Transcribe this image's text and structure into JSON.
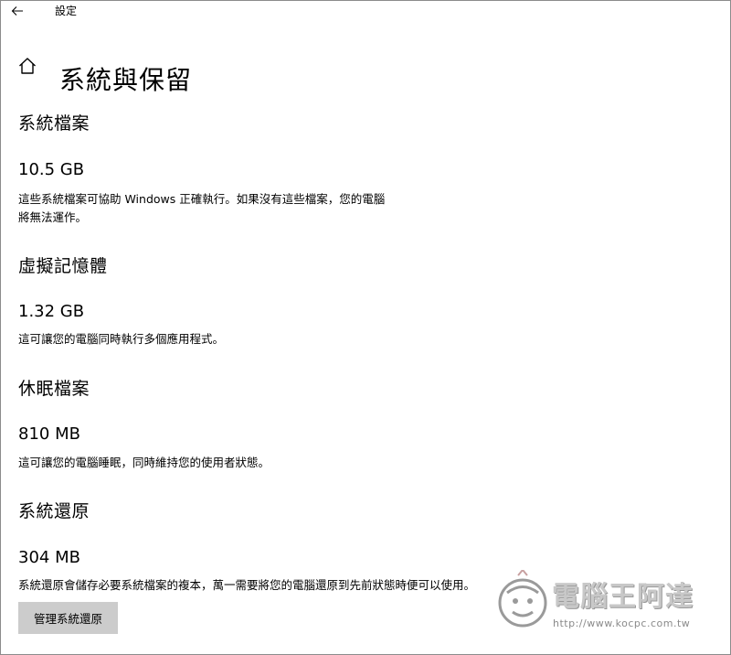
{
  "window": {
    "title": "設定"
  },
  "page": {
    "title": "系統與保留"
  },
  "sections": [
    {
      "heading": "系統檔案",
      "size": "10.5 GB",
      "description_line1": "這些系統檔案可協助 Windows 正確執行。如果沒有這些檔案，您的電腦",
      "description_line2": "將無法運作。"
    },
    {
      "heading": "虛擬記憶體",
      "size": "1.32 GB",
      "description_line1": "這可讓您的電腦同時執行多個應用程式。"
    },
    {
      "heading": "休眠檔案",
      "size": "810 MB",
      "description_line1": "這可讓您的電腦睡眠，同時維持您的使用者狀態。"
    },
    {
      "heading": "系統還原",
      "size": "304 MB",
      "description_line1": "系統還原會儲存必要系統檔案的複本，萬一需要將您的電腦還原到先前狀態時便可以使用。",
      "button_label": "管理系統還原"
    }
  ],
  "watermark": {
    "name": "電腦王阿達",
    "url": "http://www.kocpc.com.tw"
  },
  "icons": {
    "back": "back-arrow-icon",
    "home": "home-icon"
  },
  "colors": {
    "button_bg": "#cccccc",
    "window_border": "#8c8c8c"
  }
}
